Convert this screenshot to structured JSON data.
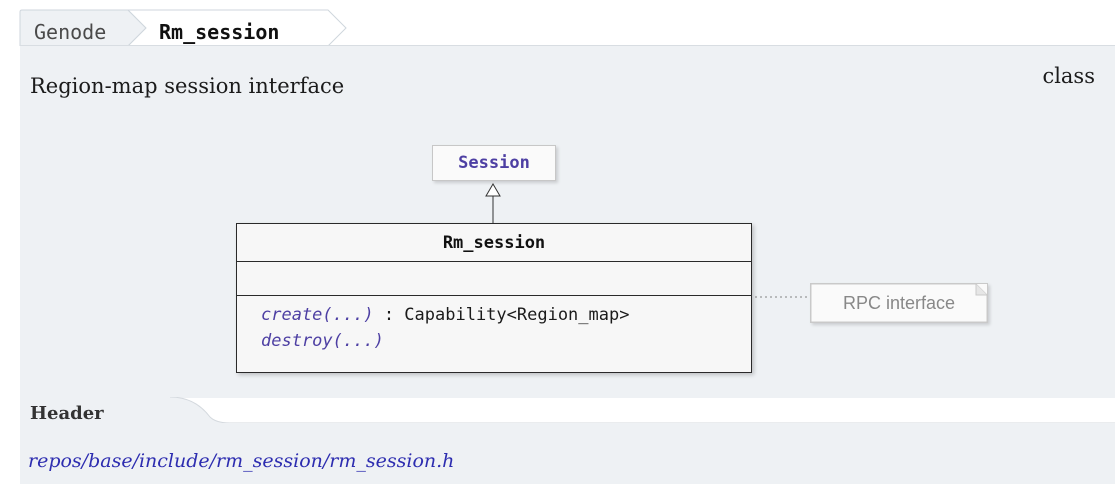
{
  "breadcrumb": {
    "parent": "Genode",
    "current": "Rm_session"
  },
  "subtitle": "Region-map session interface",
  "kind": "class",
  "diagram": {
    "base_class": "Session",
    "class_name": "Rm_session",
    "operations": [
      {
        "name": "create(...)",
        "return": " : Capability<Region_map>"
      },
      {
        "name": "destroy(...)",
        "return": ""
      }
    ],
    "note": "RPC interface"
  },
  "header": {
    "label": "Header",
    "path": "repos/base/include/rm_session/rm_session.h"
  },
  "colors": {
    "panel_bg": "#eef1f4",
    "link": "#2d2db0",
    "class_link": "#4d3fa3"
  }
}
